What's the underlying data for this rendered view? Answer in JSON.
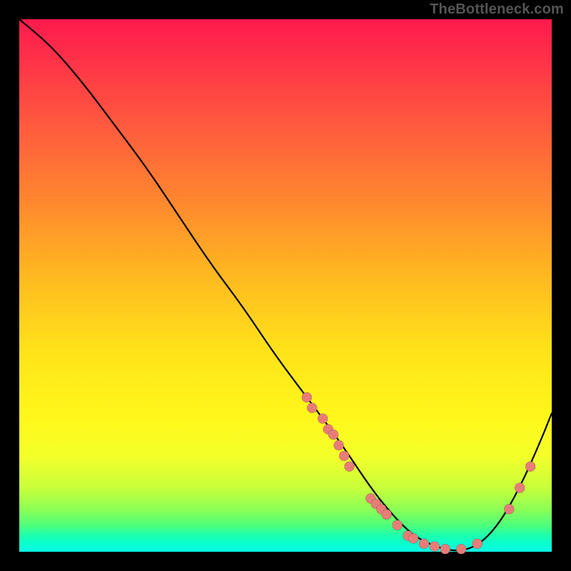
{
  "watermark": "TheBottleneck.com",
  "chart_data": {
    "type": "line",
    "title": "",
    "xlabel": "",
    "ylabel": "",
    "xlim": [
      0,
      100
    ],
    "ylim": [
      0,
      100
    ],
    "grid": false,
    "legend": false,
    "series": [
      {
        "name": "curve",
        "x": [
          0,
          6,
          12,
          18,
          24,
          30,
          36,
          42,
          48,
          54,
          60,
          66,
          70,
          74,
          78,
          82,
          86,
          90,
          94,
          98,
          100
        ],
        "y": [
          100,
          95,
          88,
          80,
          72,
          63,
          54,
          46,
          37,
          29,
          21,
          12,
          7,
          3,
          1,
          0,
          1,
          5,
          12,
          21,
          26
        ]
      }
    ],
    "points": [
      {
        "x": 54,
        "y": 29
      },
      {
        "x": 55,
        "y": 27
      },
      {
        "x": 57,
        "y": 25
      },
      {
        "x": 58,
        "y": 23
      },
      {
        "x": 59,
        "y": 22
      },
      {
        "x": 60,
        "y": 20
      },
      {
        "x": 61,
        "y": 18
      },
      {
        "x": 62,
        "y": 16
      },
      {
        "x": 66,
        "y": 10
      },
      {
        "x": 67,
        "y": 9
      },
      {
        "x": 68,
        "y": 8
      },
      {
        "x": 69,
        "y": 7
      },
      {
        "x": 71,
        "y": 5
      },
      {
        "x": 73,
        "y": 3
      },
      {
        "x": 74,
        "y": 2.5
      },
      {
        "x": 76,
        "y": 1.5
      },
      {
        "x": 78,
        "y": 1
      },
      {
        "x": 80,
        "y": 0.5
      },
      {
        "x": 83,
        "y": 0.5
      },
      {
        "x": 86,
        "y": 1.5
      },
      {
        "x": 92,
        "y": 8
      },
      {
        "x": 94,
        "y": 12
      },
      {
        "x": 96,
        "y": 16
      }
    ]
  }
}
